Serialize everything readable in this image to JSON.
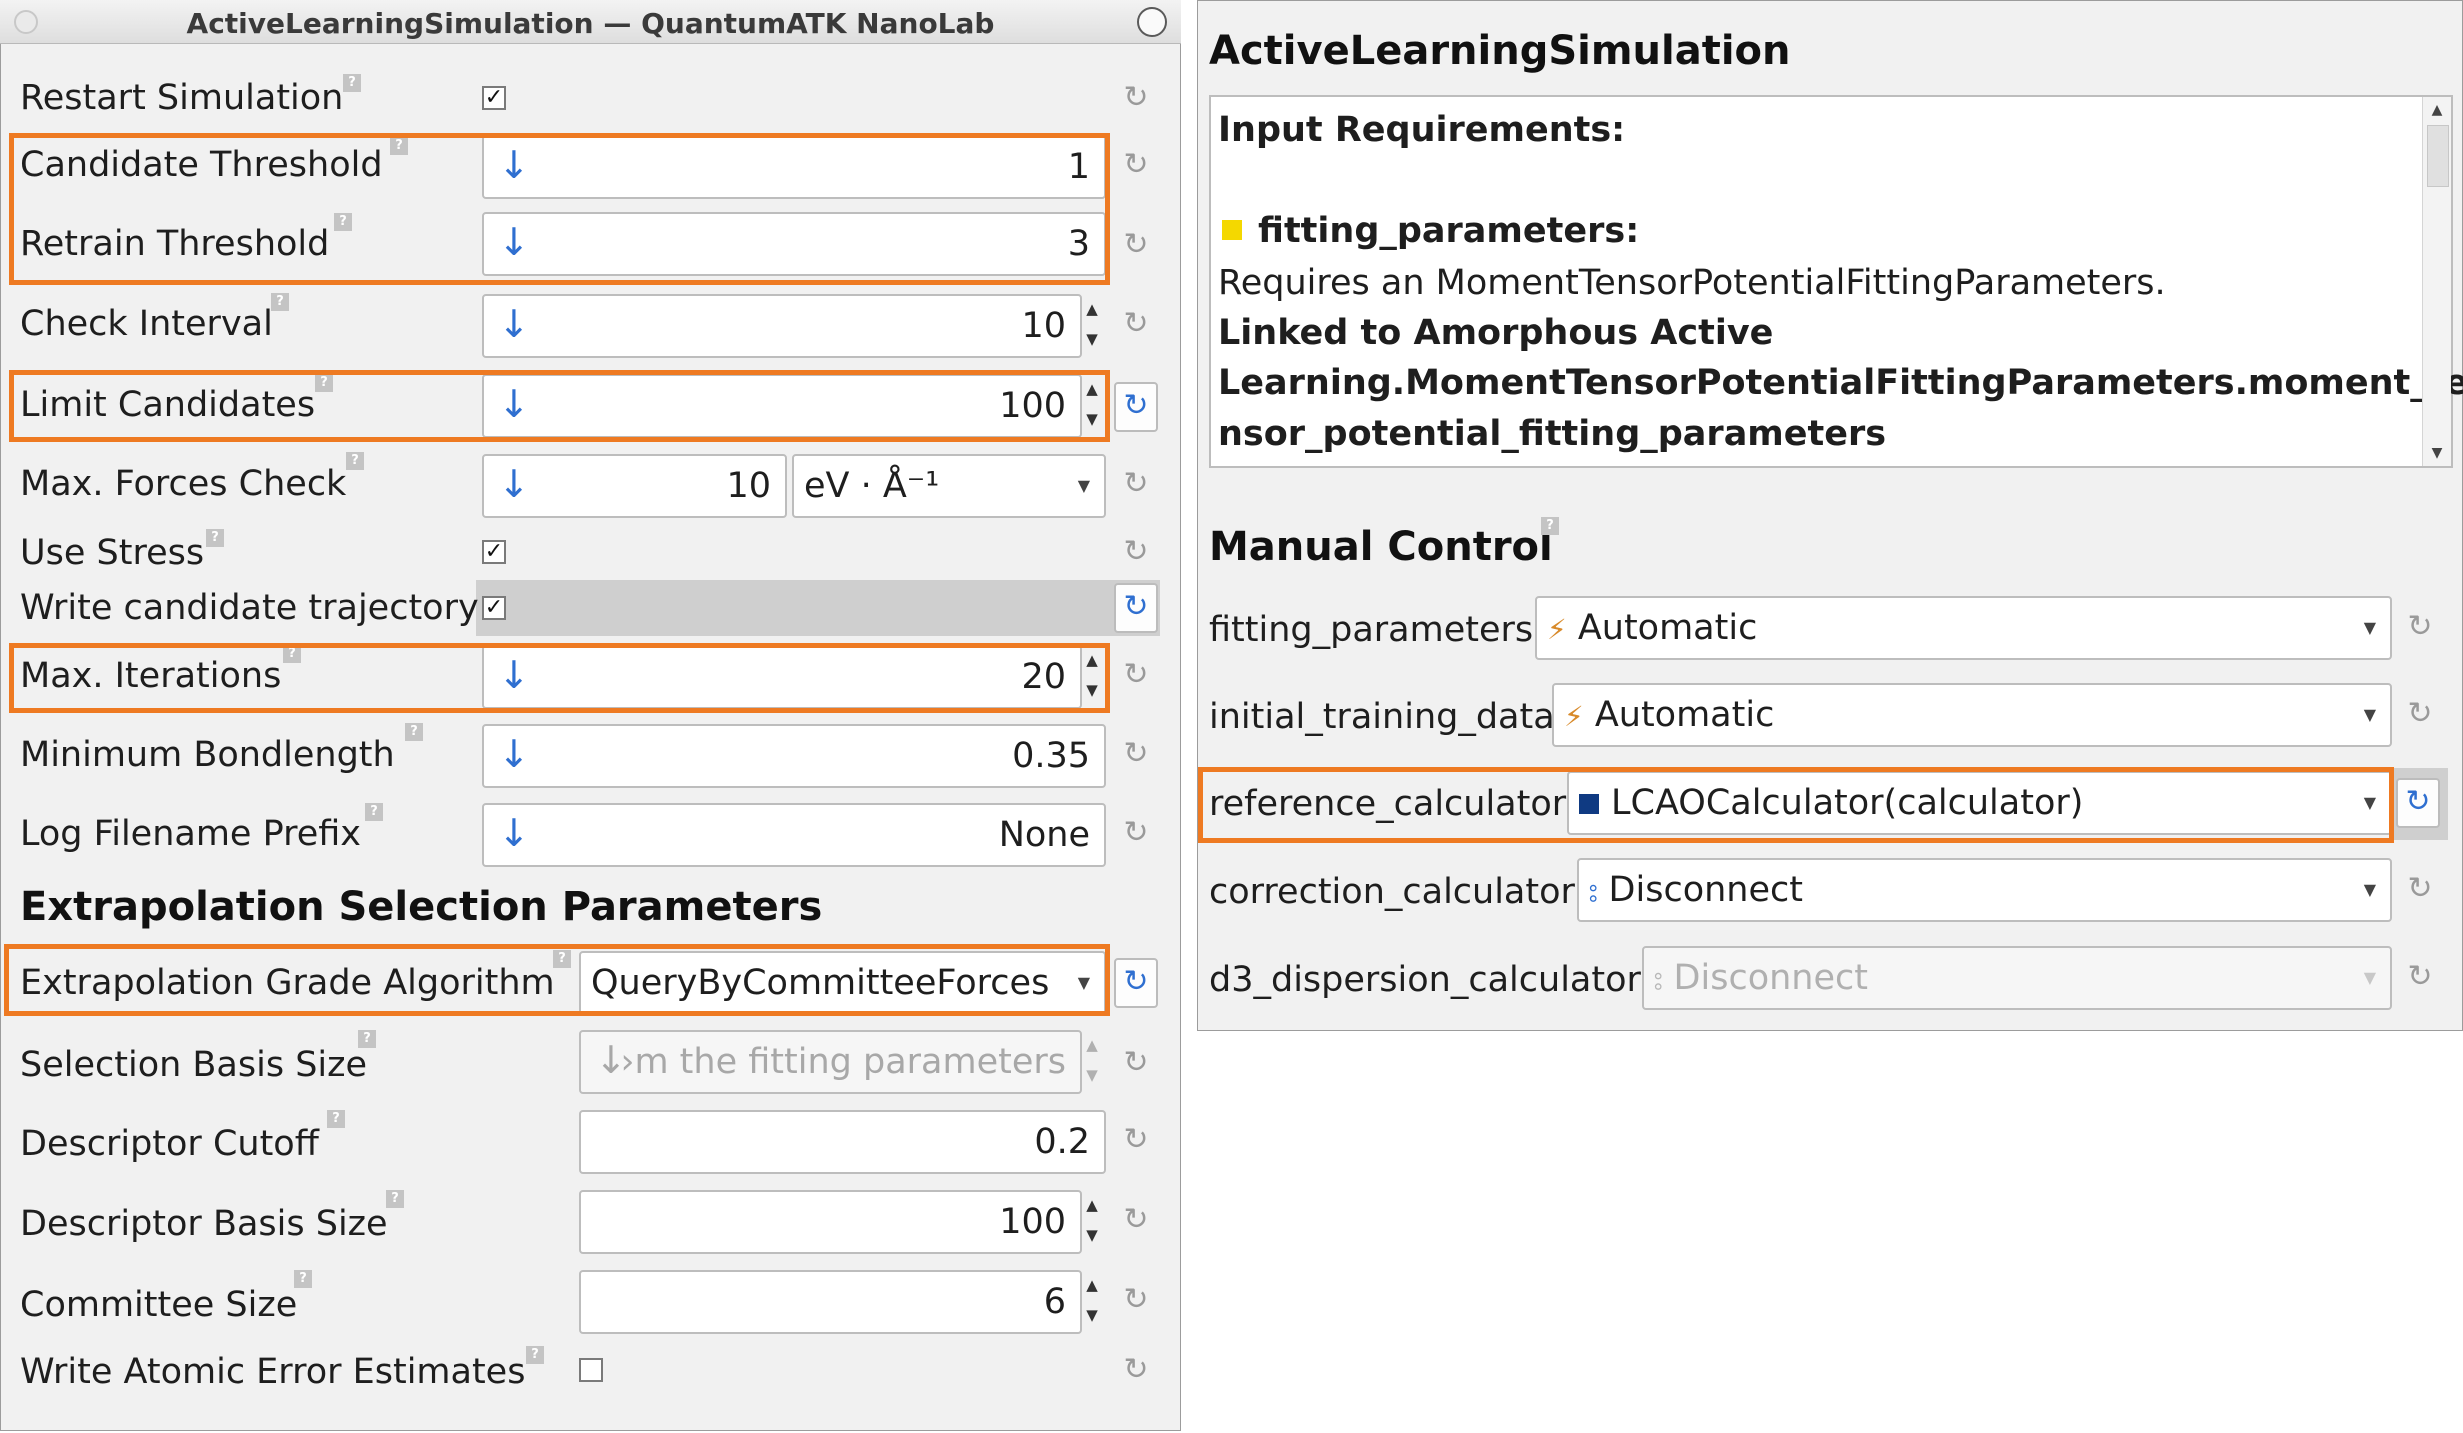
{
  "window": {
    "title": "ActiveLearningSimulation — QuantumATK NanoLab",
    "close_symbol": "×"
  },
  "fields": {
    "restart_simulation": {
      "label": "Restart Simulation",
      "checked": true
    },
    "candidate_threshold": {
      "label": "Candidate Threshold",
      "value": "1"
    },
    "retrain_threshold": {
      "label": "Retrain Threshold",
      "value": "3"
    },
    "check_interval": {
      "label": "Check Interval",
      "value": "10"
    },
    "limit_candidates": {
      "label": "Limit Candidates",
      "value": "100"
    },
    "max_forces_check": {
      "label": "Max. Forces Check",
      "value": "10",
      "unit": "eV · Å⁻¹"
    },
    "use_stress": {
      "label": "Use Stress",
      "checked": true
    },
    "write_candidate_trajectory": {
      "label": "Write candidate trajectory",
      "checked": true
    },
    "max_iterations": {
      "label": "Max. Iterations",
      "value": "20"
    },
    "minimum_bondlength": {
      "label": "Minimum Bondlength",
      "value": "0.35"
    },
    "log_filename_prefix": {
      "label": "Log Filename Prefix",
      "value": "None"
    }
  },
  "extrapolation": {
    "section_title": "Extrapolation Selection Parameters",
    "grade_algorithm": {
      "label": "Extrapolation Grade Algorithm",
      "value": "QueryByCommitteeForces"
    },
    "selection_basis_size": {
      "label": "Selection Basis Size",
      "value": "›m the fitting parameters"
    },
    "descriptor_cutoff": {
      "label": "Descriptor Cutoff",
      "value": "0.2"
    },
    "descriptor_basis_size": {
      "label": "Descriptor Basis Size",
      "value": "100"
    },
    "committee_size": {
      "label": "Committee Size",
      "value": "6"
    },
    "write_atomic_error_estimates": {
      "label": "Write Atomic Error Estimates",
      "checked": false
    }
  },
  "right": {
    "title": "ActiveLearningSimulation",
    "info": {
      "heading": "Input Requirements:",
      "param_name": "fitting_parameters:",
      "requires": "Requires an MomentTensorPotentialFittingParameters.",
      "linked_1": "Linked to Amorphous Active",
      "linked_2": "Learning.MomentTensorPotentialFittingParameters.moment_te",
      "linked_3": "nsor_potential_fitting_parameters"
    },
    "manual_control_title": "Manual Control",
    "rows": {
      "fitting_parameters": {
        "label": "fitting_parameters",
        "value": "Automatic"
      },
      "initial_training_data": {
        "label": "initial_training_data",
        "value": "Automatic"
      },
      "reference_calculator": {
        "label": "reference_calculator",
        "value": "LCAOCalculator(calculator)"
      },
      "correction_calculator": {
        "label": "correction_calculator",
        "value": "Disconnect"
      },
      "d3_dispersion_calculator": {
        "label": "d3_dispersion_calculator",
        "value": "Disconnect"
      }
    }
  },
  "icons": {
    "help": "?",
    "check": "✓",
    "down_arrow": "↓",
    "reset": "↻",
    "spin_up": "▲",
    "spin_down": "▼",
    "combo_arrow": "▼",
    "wand": "⚡",
    "link": "⦂"
  },
  "colors": {
    "highlight": "#ee7a22",
    "accent_blue": "#2f6fd0",
    "bullet_yellow": "#f4d800",
    "lcao_square": "#0f3a82"
  }
}
